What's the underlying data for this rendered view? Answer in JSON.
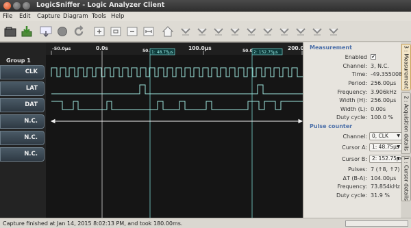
{
  "window": {
    "title": "LogicSniffer - Logic Analyzer Client"
  },
  "menu": [
    "File",
    "Edit",
    "Capture",
    "Diagram",
    "Tools",
    "Help"
  ],
  "toolbar_icons": [
    "open-file-icon",
    "save-icon",
    "capture-icon",
    "stop-icon",
    "repeat-capture-icon",
    "zoom-in-icon",
    "zoom-default-icon",
    "zoom-out-icon",
    "zoom-fit-icon",
    "home-icon",
    "goto-cursor-1-icon",
    "goto-cursor-2-icon",
    "goto-cursor-3-icon",
    "goto-cursor-4-icon",
    "goto-cursor-5-icon",
    "goto-cursor-6-icon",
    "goto-cursor-7-icon",
    "goto-cursor-8-icon",
    "goto-cursor-9-icon"
  ],
  "signal": {
    "group_label": "Group 1",
    "timeline": [
      "-50.0μs",
      "0.0s",
      "50.0",
      "100.0μs",
      "50.0",
      "200.0"
    ],
    "cursors": [
      "1: 48.75μs",
      "2: 152.75μs"
    ],
    "channels": [
      {
        "label": "CLK",
        "type": "clock"
      },
      {
        "label": "LAT",
        "type": "pulse"
      },
      {
        "label": "DAT",
        "type": "data"
      },
      {
        "label": "N.C.",
        "type": "arrow"
      },
      {
        "label": "N.C.",
        "type": "none"
      },
      {
        "label": "N.C.",
        "type": "none"
      }
    ]
  },
  "measurement": {
    "heading": "Measurement",
    "enabled_label": "Enabled",
    "enabled": "✔",
    "rows": [
      {
        "label": "Channel:",
        "value": "3, N.C."
      },
      {
        "label": "Time:",
        "value": "-49.355008078μs"
      },
      {
        "label": "Period:",
        "value": "256.00μs"
      },
      {
        "label": "Frequency:",
        "value": "3.906kHz"
      },
      {
        "label": "Width (H):",
        "value": "256.00μs"
      },
      {
        "label": "Width (L):",
        "value": "0.00s"
      },
      {
        "label": "Duty cycle:",
        "value": "100.0 %"
      }
    ]
  },
  "pulse_counter": {
    "heading": "Pulse counter",
    "channel_label": "Channel:",
    "channel_value": "0, CLK",
    "cursor_a_label": "Cursor A:",
    "cursor_a_value": "1: 48.75μs",
    "cursor_b_label": "Cursor B:",
    "cursor_b_value": "2: 152.75μs",
    "rows": [
      {
        "label": "Pulses:",
        "value": "7 (↑8, ↑7)"
      },
      {
        "label": "ΔT (B-A):",
        "value": "104.00μs"
      },
      {
        "label": "Frequency:",
        "value": "73.854kHz"
      },
      {
        "label": "Duty cycle:",
        "value": "31.9 %"
      }
    ]
  },
  "side_tabs": [
    "3 : Measurement",
    "2 : Acquisition details",
    "1 : Cursor details"
  ],
  "status": {
    "text": "Capture finished at Jan 14, 2015 8:02:13 PM, and took 180.00ms.",
    "progress": 0
  },
  "colors": {
    "accent": "#4a6ea8",
    "signal": "#9ee8e0",
    "cursor": "#7fdcd6"
  }
}
